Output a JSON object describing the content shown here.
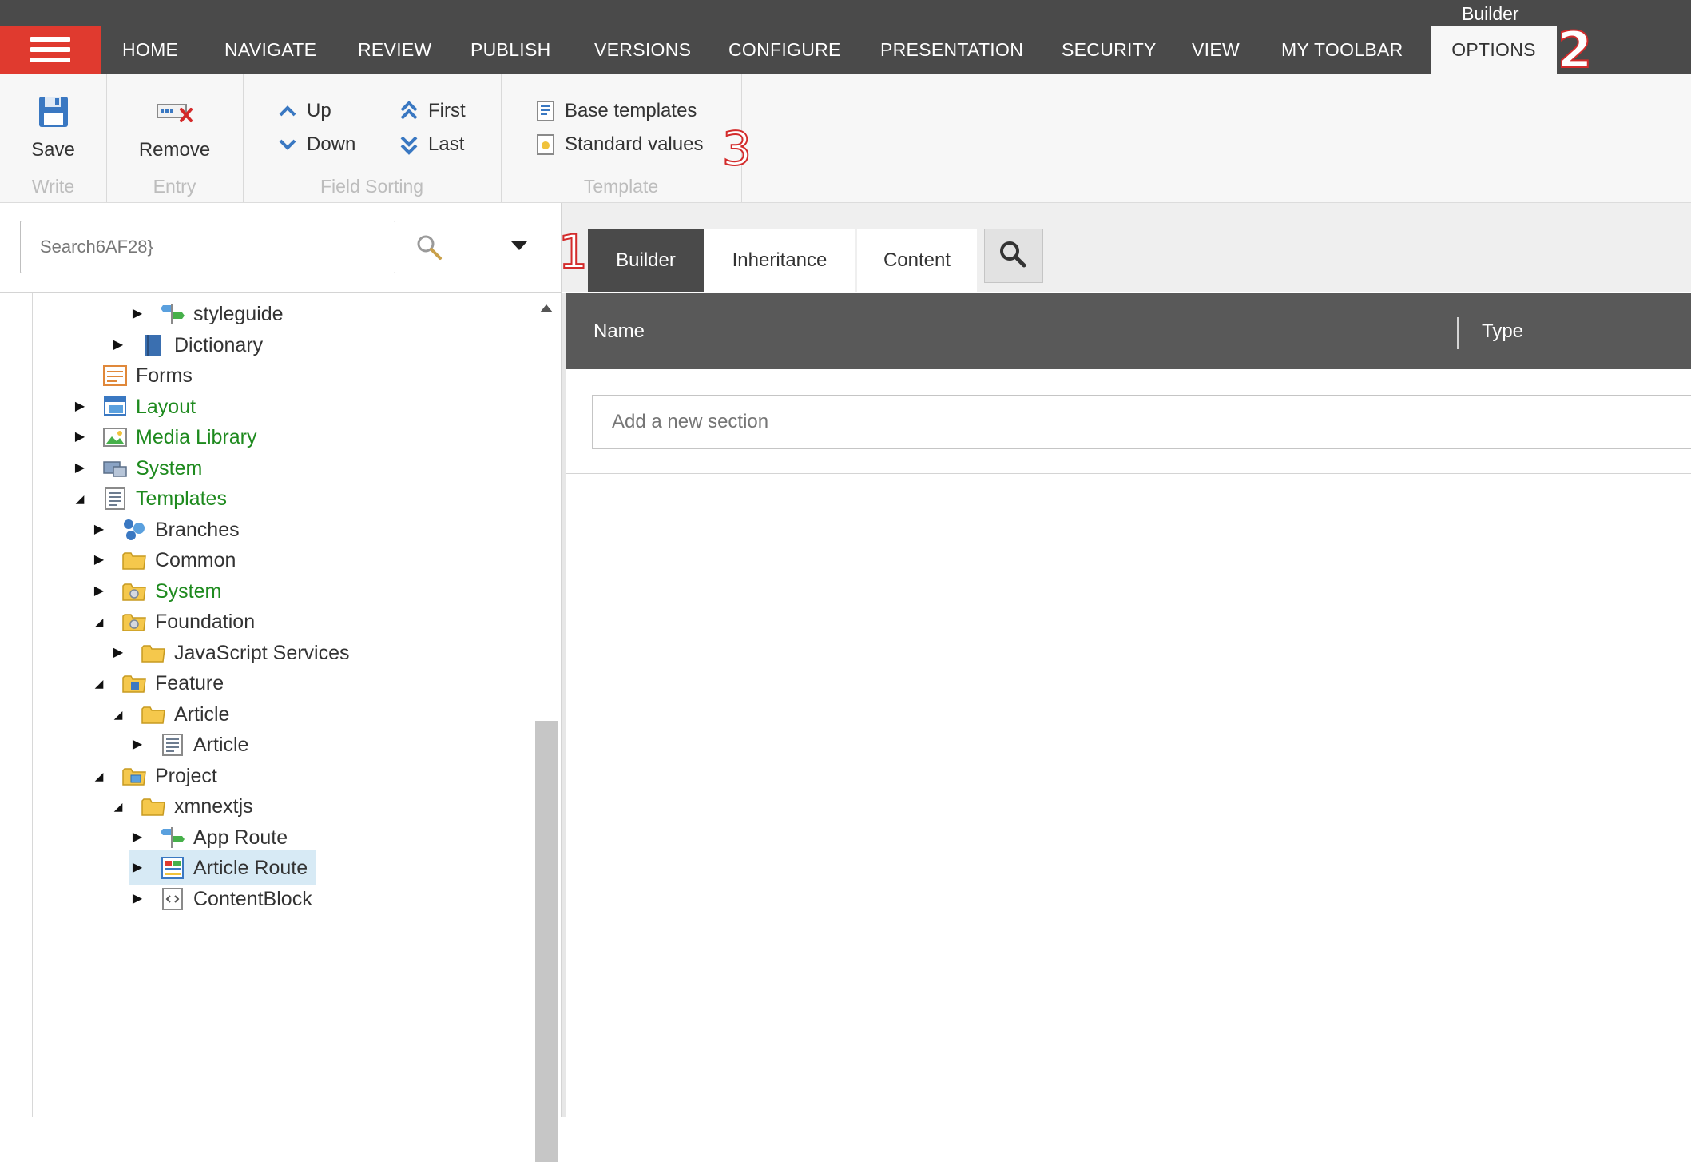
{
  "nav": {
    "tabs": [
      "HOME",
      "NAVIGATE",
      "REVIEW",
      "PUBLISH",
      "VERSIONS",
      "CONFIGURE",
      "PRESENTATION",
      "SECURITY",
      "VIEW",
      "MY TOOLBAR"
    ],
    "context_label": "Builder",
    "active_tab": "OPTIONS",
    "annotation_2": "2",
    "colors": {
      "bar": "#4a4a4a",
      "menu_button": "#e03a2f",
      "annotation": "#d32b2b"
    }
  },
  "ribbon": {
    "write": {
      "save_label": "Save",
      "group_label": "Write"
    },
    "entry": {
      "remove_label": "Remove",
      "group_label": "Entry"
    },
    "sorting": {
      "up": "Up",
      "down": "Down",
      "first": "First",
      "last": "Last",
      "group_label": "Field Sorting"
    },
    "template": {
      "base_templates": "Base templates",
      "standard_values": "Standard values",
      "group_label": "Template"
    },
    "annotation_3": "3"
  },
  "search": {
    "value": "Search6AF28}"
  },
  "tree": {
    "items": [
      {
        "label": "styleguide",
        "icon": "route-icon",
        "arrow": "collapsed",
        "green": false
      },
      {
        "label": "Dictionary",
        "icon": "dictionary-icon",
        "arrow": "collapsed",
        "green": false
      },
      {
        "label": "Forms",
        "icon": "forms-icon",
        "arrow": "none",
        "green": false
      },
      {
        "label": "Layout",
        "icon": "layout-icon",
        "arrow": "collapsed",
        "green": true
      },
      {
        "label": "Media Library",
        "icon": "media-library-icon",
        "arrow": "collapsed",
        "green": true
      },
      {
        "label": "System",
        "icon": "system-icon",
        "arrow": "collapsed",
        "green": true
      },
      {
        "label": "Templates",
        "icon": "templates-icon",
        "arrow": "expanded",
        "green": true
      },
      {
        "label": "Branches",
        "icon": "branches-icon",
        "arrow": "collapsed",
        "green": false
      },
      {
        "label": "Common",
        "icon": "folder-icon",
        "arrow": "collapsed",
        "green": false
      },
      {
        "label": "System",
        "icon": "folder-gear-icon",
        "arrow": "collapsed",
        "green": true
      },
      {
        "label": "Foundation",
        "icon": "folder-gear-icon",
        "arrow": "expanded",
        "green": false
      },
      {
        "label": "JavaScript Services",
        "icon": "folder-icon",
        "arrow": "collapsed",
        "green": false
      },
      {
        "label": "Feature",
        "icon": "folder-feature-icon",
        "arrow": "expanded",
        "green": false
      },
      {
        "label": "Article",
        "icon": "folder-icon",
        "arrow": "expanded",
        "green": false
      },
      {
        "label": "Article",
        "icon": "template-icon",
        "arrow": "collapsed",
        "green": false
      },
      {
        "label": "Project",
        "icon": "folder-project-icon",
        "arrow": "expanded",
        "green": false
      },
      {
        "label": "xmnextjs",
        "icon": "folder-icon",
        "arrow": "expanded",
        "green": false
      },
      {
        "label": "App Route",
        "icon": "route-icon",
        "arrow": "collapsed",
        "green": false
      },
      {
        "label": "Article Route",
        "icon": "article-route-icon",
        "arrow": "collapsed",
        "green": false,
        "selected": true
      },
      {
        "label": "ContentBlock",
        "icon": "content-block-icon",
        "arrow": "collapsed",
        "green": false
      }
    ]
  },
  "editor": {
    "tabs": [
      "Builder",
      "Inheritance",
      "Content"
    ],
    "active_tab": "Builder",
    "annotation_1": "1",
    "columns": {
      "name": "Name",
      "type": "Type"
    },
    "section_placeholder": "Add a new section"
  }
}
